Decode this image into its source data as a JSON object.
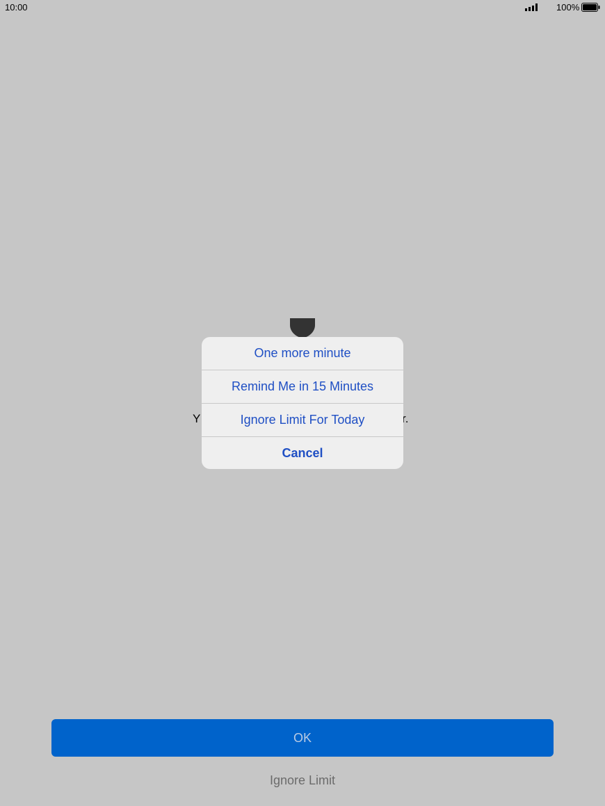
{
  "status_bar": {
    "time": "10:00",
    "signal_icon": "signal-bars-icon",
    "battery_percent": "100%",
    "battery_icon": "battery-full-icon"
  },
  "background": {
    "icon": "hourglass-icon",
    "message_visible_left": "Y",
    "message_visible_right": "r."
  },
  "action_menu": {
    "items": [
      {
        "label": "One more minute"
      },
      {
        "label": "Remind Me in 15 Minutes"
      },
      {
        "label": "Ignore Limit For Today"
      },
      {
        "label": "Cancel"
      }
    ]
  },
  "footer": {
    "ok_label": "OK",
    "ignore_label": "Ignore Limit"
  },
  "colors": {
    "background": "#c6c6c6",
    "accent": "#0063cb",
    "menu_text": "#1f4fc4",
    "menu_background": "#efefef"
  }
}
